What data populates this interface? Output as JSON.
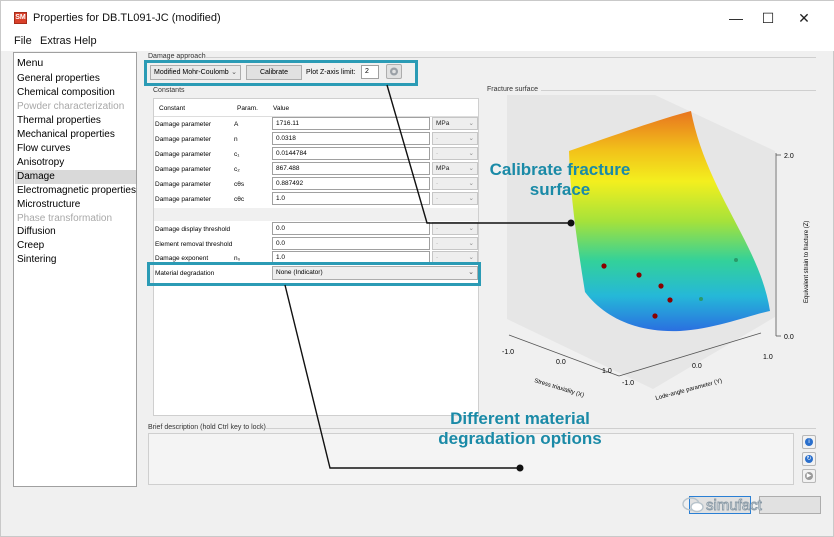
{
  "window": {
    "title": "Properties for DB.TL091-JC (modified)",
    "app_icon_text": "SM",
    "minimize": "—",
    "maximize": "☐",
    "close": "✕"
  },
  "menubar": {
    "items": [
      "File",
      "Extras",
      "Help"
    ]
  },
  "sidebar": {
    "header": "Menu",
    "items": [
      {
        "label": "General properties",
        "state": "normal"
      },
      {
        "label": "Chemical composition",
        "state": "normal"
      },
      {
        "label": "Powder characterization",
        "state": "disabled"
      },
      {
        "label": "Thermal properties",
        "state": "normal"
      },
      {
        "label": "Mechanical properties",
        "state": "normal"
      },
      {
        "label": "Flow curves",
        "state": "normal"
      },
      {
        "label": "Anisotropy",
        "state": "normal"
      },
      {
        "label": "Damage",
        "state": "selected"
      },
      {
        "label": "Electromagnetic properties",
        "state": "normal"
      },
      {
        "label": "Microstructure",
        "state": "normal"
      },
      {
        "label": "Phase transformation",
        "state": "disabled"
      },
      {
        "label": "Diffusion",
        "state": "normal"
      },
      {
        "label": "Creep",
        "state": "normal"
      },
      {
        "label": "Sintering",
        "state": "normal"
      }
    ]
  },
  "damage_approach": {
    "group_label": "Damage approach",
    "model": "Modified Mohr-Coulomb",
    "calibrate_label": "Calibrate",
    "zlimit_label": "Plot Z-axis limit:",
    "zlimit_value": "2"
  },
  "constants": {
    "group_label": "Constants",
    "headers": [
      "Constant",
      "Param.",
      "Value"
    ],
    "rows": [
      {
        "name": "Damage parameter",
        "param": "A",
        "value": "1716.11",
        "unit": "MPa",
        "unit_enabled": true
      },
      {
        "name": "Damage parameter",
        "param": "n",
        "value": "0.0318",
        "unit": "-",
        "unit_enabled": false
      },
      {
        "name": "Damage parameter",
        "param": "c₁",
        "value": "0.0144784",
        "unit": "-",
        "unit_enabled": false
      },
      {
        "name": "Damage parameter",
        "param": "c₂",
        "value": "867.488",
        "unit": "MPa",
        "unit_enabled": true
      },
      {
        "name": "Damage parameter",
        "param": "cθs",
        "value": "0.887492",
        "unit": "-",
        "unit_enabled": false
      },
      {
        "name": "Damage parameter",
        "param": "cθc",
        "value": "1.0",
        "unit": "-",
        "unit_enabled": false
      }
    ],
    "extra_rows": [
      {
        "name": "Damage display threshold",
        "param": "",
        "value": "0.0",
        "unit": "-"
      },
      {
        "name": "Element removal threshold",
        "param": "",
        "value": "0.0",
        "unit": "-"
      },
      {
        "name": "Damage exponent",
        "param": "n₀",
        "value": "1.0",
        "unit": "-"
      }
    ],
    "degradation_label": "Material degradation",
    "degradation_value": "None (Indicator)"
  },
  "fracture_surface": {
    "label": "Fracture surface",
    "z_ticks": [
      "2.0",
      "0.0"
    ],
    "z_label": "Equivalent strain to fracture (Z)",
    "x_ticks": [
      "-1.0",
      "0.0",
      "1.0"
    ],
    "x_label": "Stress triaxiality (X)",
    "y_ticks": [
      "-1.0",
      "0.0",
      "1.0"
    ],
    "y_label": "Lode-angle parameter (Y)"
  },
  "brief": {
    "label": "Brief description (hold Ctrl key to lock)"
  },
  "annotations": {
    "calibrate": [
      "Calibrate fracture",
      "surface"
    ],
    "degradation": [
      "Different material",
      "degradation options"
    ]
  },
  "watermark": "simufact",
  "colors": {
    "highlight": "#2b9bb5",
    "annotation": "#1a8aa7",
    "point": "#8b0000"
  }
}
